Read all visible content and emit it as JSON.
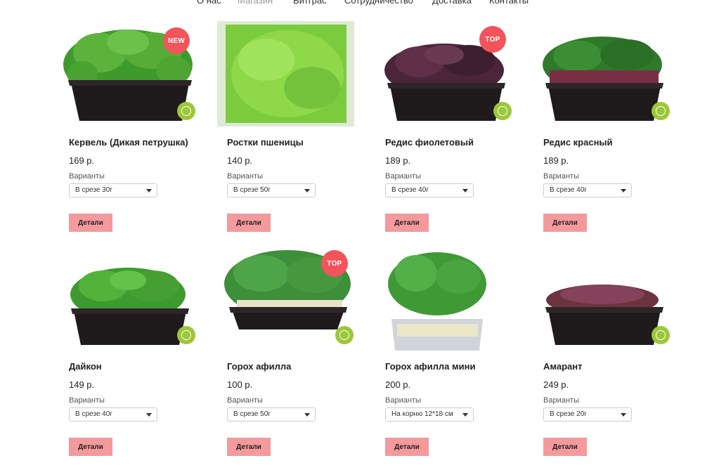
{
  "nav": {
    "items": [
      {
        "label": "О нас"
      },
      {
        "label": "Магазин"
      },
      {
        "label": "Витграс"
      },
      {
        "label": "Сотрудничество"
      },
      {
        "label": "Доставка"
      },
      {
        "label": "Контакты"
      }
    ]
  },
  "products": [
    {
      "title": "Кервель (Дикая петрушка)",
      "price": "169 р.",
      "variants_label": "Варианты",
      "variant": "В срезе 30г",
      "button": "Детали",
      "badge": "NEW",
      "image": "chervil-tray"
    },
    {
      "title": "Ростки пшеницы",
      "price": "140 р.",
      "variants_label": "Варианты",
      "variant": "В срезе 50г",
      "button": "Детали",
      "badge": "",
      "image": "wheatgrass"
    },
    {
      "title": "Редис фиолетовый",
      "price": "189 р.",
      "variants_label": "Варианты",
      "variant": "В срезе 40г",
      "button": "Детали",
      "badge": "TOP",
      "image": "purple-radish-tray"
    },
    {
      "title": "Редис красный",
      "price": "189 р.",
      "variants_label": "Варианты",
      "variant": "В срезе 40г",
      "button": "Детали",
      "badge": "",
      "image": "red-radish-tray"
    },
    {
      "title": "Дайкон",
      "price": "149 р.",
      "variants_label": "Варианты",
      "variant": "В срезе 40г",
      "button": "Детали",
      "badge": "",
      "image": "daikon-tray"
    },
    {
      "title": "Горох афилла",
      "price": "100 р.",
      "variants_label": "Варианты",
      "variant": "В срезе 50г",
      "button": "Детали",
      "badge": "TOP",
      "image": "pea-tray"
    },
    {
      "title": "Горох афилла мини",
      "price": "200 р.",
      "variants_label": "Варианты",
      "variant": "На корню 12*18 см",
      "button": "Детали",
      "badge": "",
      "image": "pea-mini-container"
    },
    {
      "title": "Амарант",
      "price": "249 р.",
      "variants_label": "Варианты",
      "variant": "В срезе 20г",
      "button": "Детали",
      "badge": "",
      "image": "amaranth-tray"
    }
  ],
  "colors": {
    "badge": "#f2545b",
    "button": "#f4999c",
    "brand": "#9dc73a",
    "tray": "#1f1a1c"
  }
}
